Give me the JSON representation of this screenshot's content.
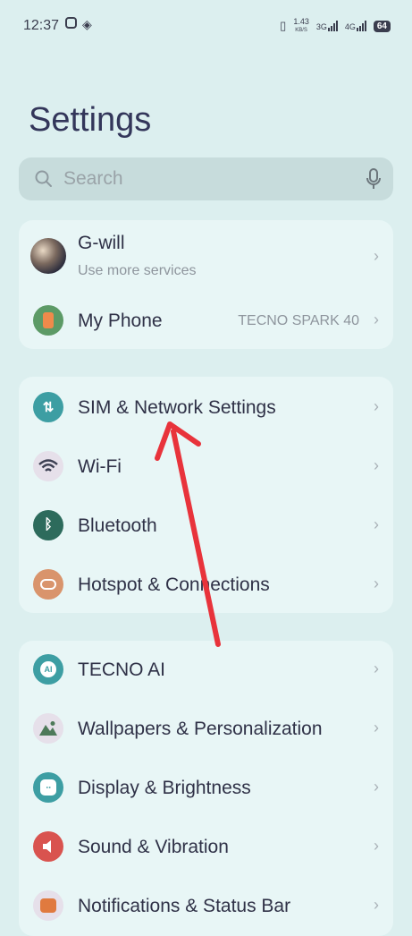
{
  "status": {
    "time": "12:37",
    "speed_value": "1.43",
    "speed_unit": "KB/S",
    "net1": "3G",
    "net2": "4G",
    "battery": "64"
  },
  "title": "Settings",
  "search": {
    "placeholder": "Search"
  },
  "account": {
    "name": "G-will",
    "subtitle": "Use more services"
  },
  "my_phone": {
    "label": "My Phone",
    "value": "TECNO SPARK 40"
  },
  "network_group": [
    {
      "label": "SIM & Network Settings",
      "icon": "sim-icon",
      "color": "#3d9ea3"
    },
    {
      "label": "Wi-Fi",
      "icon": "wifi-icon",
      "color": "#3c3f52"
    },
    {
      "label": "Bluetooth",
      "icon": "bluetooth-icon",
      "color": "#2d6b5c"
    },
    {
      "label": "Hotspot & Connections",
      "icon": "hotspot-icon",
      "color": "#d9946c"
    }
  ],
  "system_group": [
    {
      "label": "TECNO AI",
      "icon": "ai-icon",
      "color": "#3d9ea3"
    },
    {
      "label": "Wallpapers & Personalization",
      "icon": "wallpaper-icon",
      "color": "#4e7a5a"
    },
    {
      "label": "Display & Brightness",
      "icon": "display-icon",
      "color": "#3d9ea3"
    },
    {
      "label": "Sound & Vibration",
      "icon": "sound-icon",
      "color": "#d9534f"
    },
    {
      "label": "Notifications & Status Bar",
      "icon": "notification-icon",
      "color": "#e07a3f"
    }
  ],
  "annotation": {
    "color": "#e8333b"
  }
}
